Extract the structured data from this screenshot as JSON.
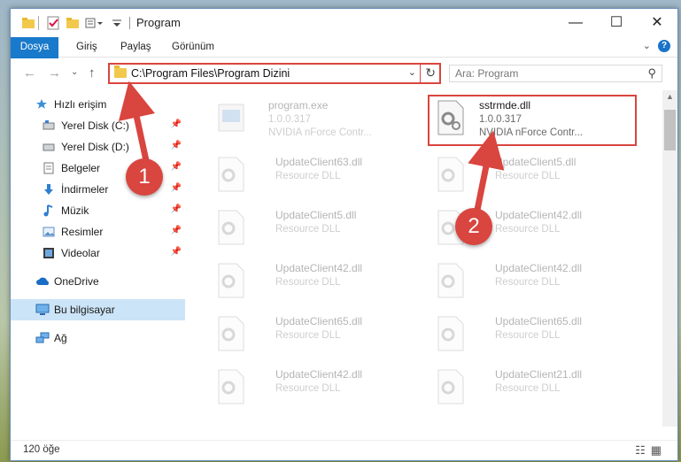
{
  "window": {
    "title": "Program"
  },
  "ribbon": {
    "tabs": [
      "Dosya",
      "Giriş",
      "Paylaş",
      "Görünüm"
    ]
  },
  "address": {
    "path": "C:\\Program Files\\Program Dizini"
  },
  "search": {
    "placeholder": "Ara: Program"
  },
  "sidebar": {
    "items": [
      {
        "label": "Hızlı erişim",
        "icon": "star-icon"
      },
      {
        "label": "Yerel Disk (C:)",
        "icon": "drive-icon",
        "pinned": true
      },
      {
        "label": "Yerel Disk (D:)",
        "icon": "drive-icon",
        "pinned": true
      },
      {
        "label": "Belgeler",
        "icon": "document-icon",
        "pinned": true
      },
      {
        "label": "İndirmeler",
        "icon": "download-icon",
        "pinned": true
      },
      {
        "label": "Müzik",
        "icon": "music-icon",
        "pinned": true
      },
      {
        "label": "Resimler",
        "icon": "pictures-icon",
        "pinned": true
      },
      {
        "label": "Videolar",
        "icon": "video-icon",
        "pinned": true
      },
      {
        "label": "OneDrive",
        "icon": "cloud-icon"
      },
      {
        "label": "Bu bilgisayar",
        "icon": "computer-icon",
        "selected": true
      },
      {
        "label": "Ağ",
        "icon": "network-icon"
      }
    ]
  },
  "files": [
    {
      "name": "program.exe",
      "line2": "1.0.0.317",
      "line3": "NVIDIA nForce Contr...",
      "faded": true,
      "kind": "exe"
    },
    {
      "name": "sstrmde.dll",
      "line2": "1.0.0.317",
      "line3": "NVIDIA nForce Contr...",
      "faded": false,
      "kind": "dll"
    },
    {
      "name": "UpdateClient63.dll",
      "line2": "Resource DLL",
      "faded": true,
      "kind": "dll"
    },
    {
      "name": "UpdateClient5.dll",
      "line2": "Resource DLL",
      "faded": true,
      "kind": "dll"
    },
    {
      "name": "UpdateClient5.dll",
      "line2": "Resource DLL",
      "faded": true,
      "kind": "dll"
    },
    {
      "name": "UpdateClient42.dll",
      "line2": "Resource DLL",
      "faded": true,
      "kind": "dll"
    },
    {
      "name": "UpdateClient42.dll",
      "line2": "Resource DLL",
      "faded": true,
      "kind": "dll"
    },
    {
      "name": "UpdateClient42.dll",
      "line2": "Resource DLL",
      "faded": true,
      "kind": "dll"
    },
    {
      "name": "UpdateClient65.dll",
      "line2": "Resource DLL",
      "faded": true,
      "kind": "dll"
    },
    {
      "name": "UpdateClient65.dll",
      "line2": "Resource DLL",
      "faded": true,
      "kind": "dll"
    },
    {
      "name": "UpdateClient42.dll",
      "line2": "Resource DLL",
      "faded": true,
      "kind": "dll"
    },
    {
      "name": "UpdateClient21.dll",
      "line2": "Resource DLL",
      "faded": true,
      "kind": "dll"
    }
  ],
  "status": {
    "count": "120 öğe"
  },
  "callouts": [
    "1",
    "2"
  ],
  "colors": {
    "accent": "#1979ca",
    "callout": "#d9453f",
    "selection": "#cce4f7"
  }
}
